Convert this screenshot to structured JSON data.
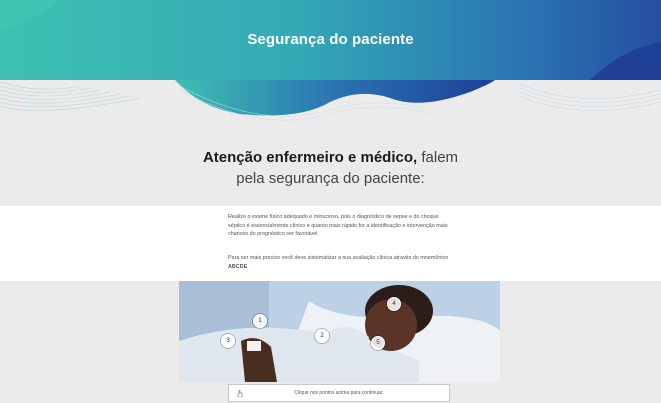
{
  "header": {
    "title": "Segurança do paciente"
  },
  "headline": {
    "bold": "Atenção enfermeiro e médico,",
    "rest1": " falem",
    "line2": "pela segurança do paciente:"
  },
  "body": {
    "paragraph1": "Realize o exame físico adequado e minucioso, pois o diagnóstico de sepse e do choque séptico é essencialmente clínico e quanto mais rápido for a identificação e intervenção mais chances do prognóstico ser favorável.",
    "paragraph2_start": "Para ser mais preciso você deve sistematizar a sua avaliação clínica através do mnemônico ",
    "paragraph2_bold": "ABCDE",
    "paragraph2_end": "."
  },
  "hotspots": [
    {
      "label": "3"
    },
    {
      "label": "1"
    },
    {
      "label": "2"
    },
    {
      "label": "4"
    },
    {
      "label": "5"
    }
  ],
  "footer": {
    "instruction": "Clique nos pontos acima para continuar.",
    "icon": "pointer-hand-icon"
  },
  "colors": {
    "header_start": "#3ec1b1",
    "header_end": "#264f9f",
    "background": "#ebebeb"
  }
}
